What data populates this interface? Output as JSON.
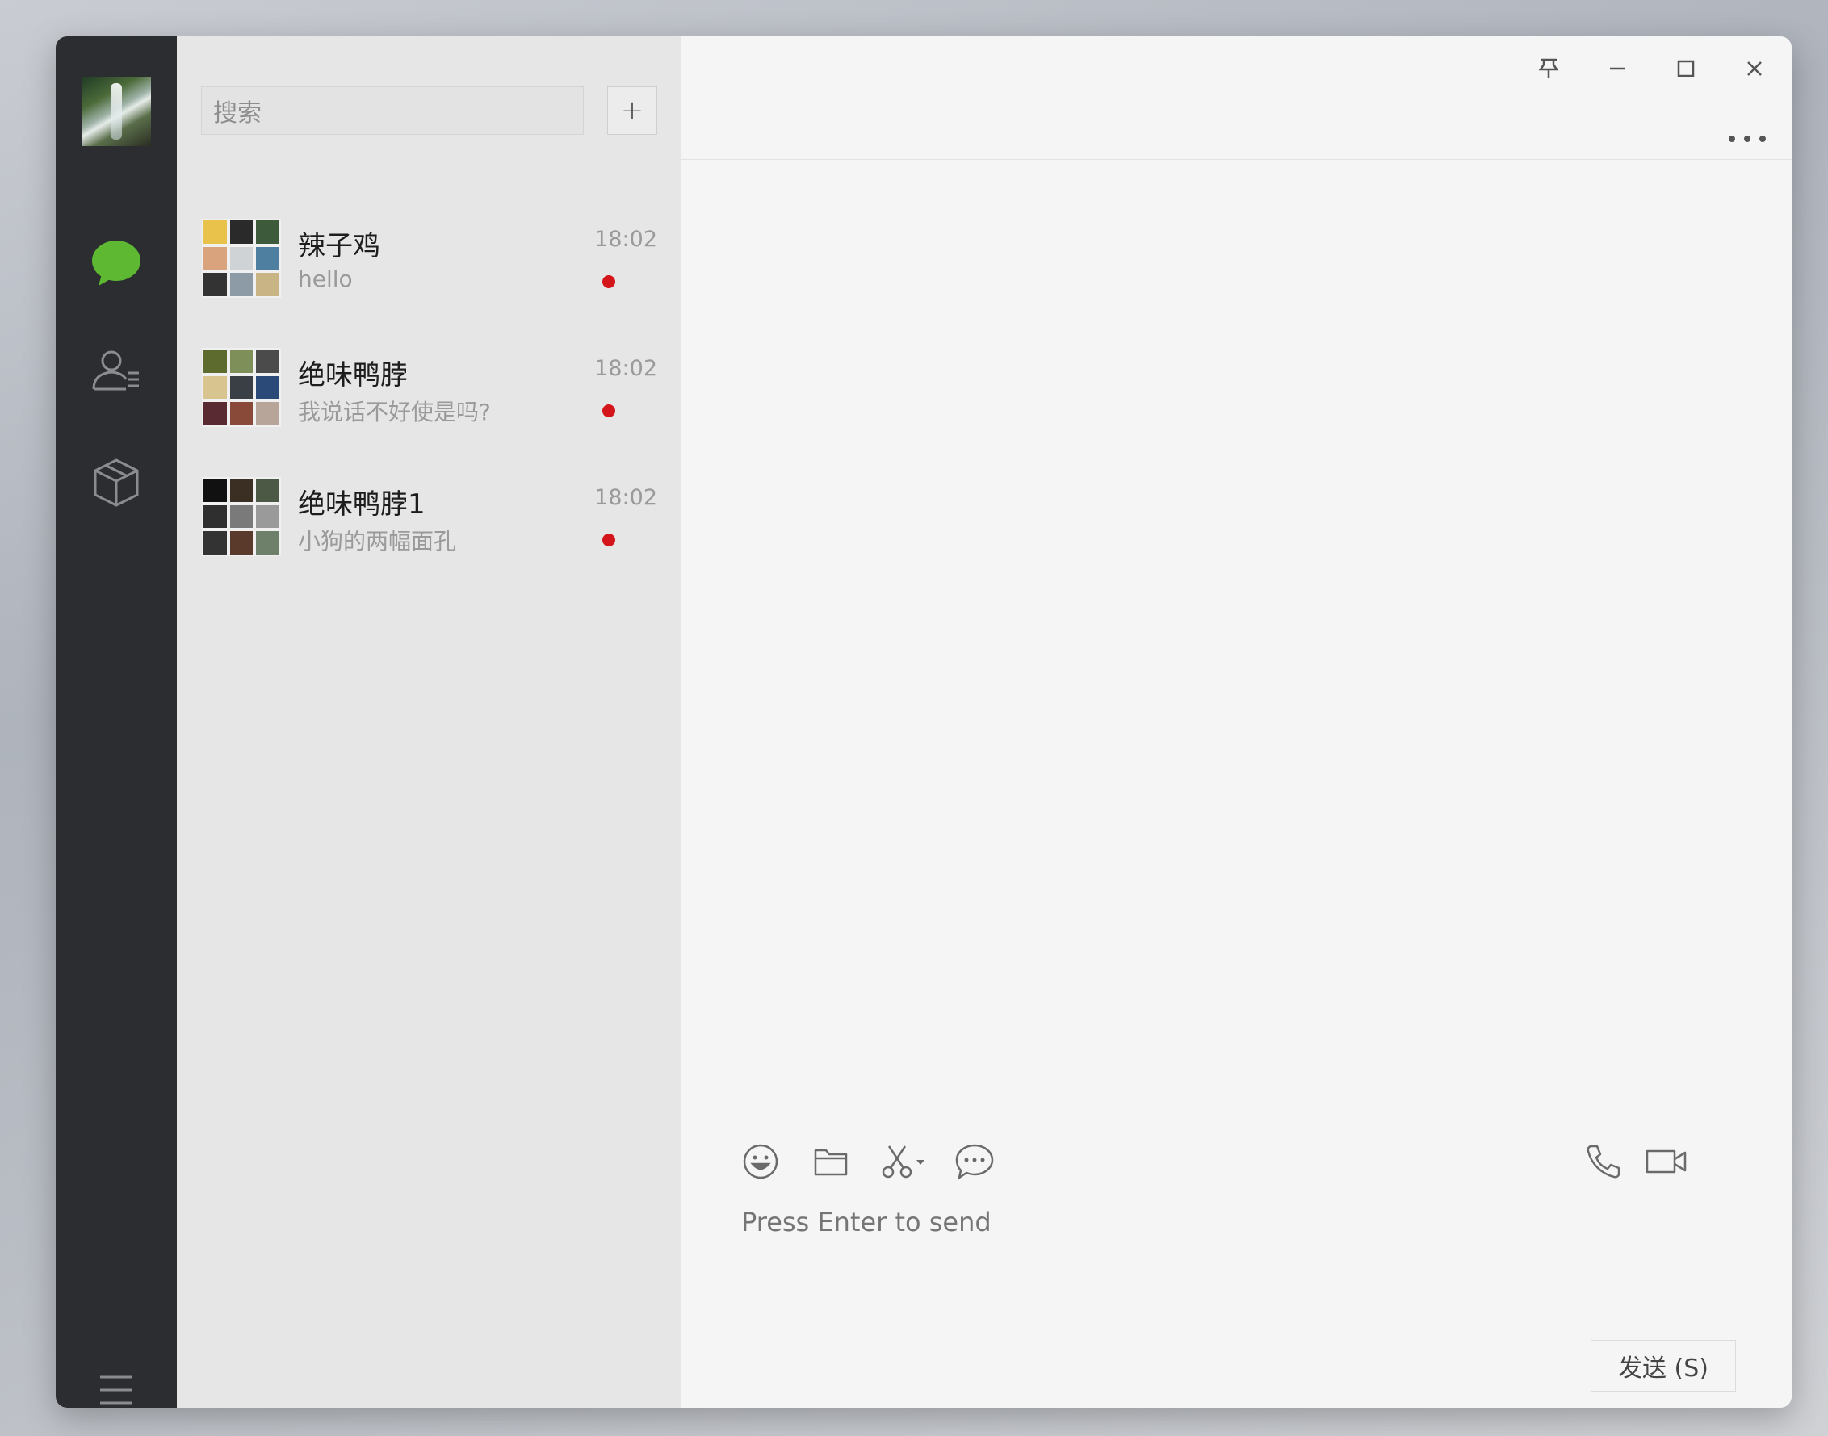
{
  "search": {
    "placeholder": "搜索"
  },
  "list": {
    "add_label": "+"
  },
  "conversations": [
    {
      "name": "辣子鸡",
      "preview": "hello",
      "time": "18:02",
      "unread": true
    },
    {
      "name": "绝味鸭脖",
      "preview": "我说话不好使是吗?",
      "time": "18:02",
      "unread": true
    },
    {
      "name": "绝味鸭脖1",
      "preview": "小狗的两幅面孔",
      "time": "18:02",
      "unread": true
    }
  ],
  "composer": {
    "placeholder": "Press Enter to send",
    "send_label": "发送 (S)"
  },
  "icons": {
    "rail": [
      "chat-icon",
      "contacts-icon",
      "favorites-icon",
      "menu-icon"
    ],
    "titlebar": [
      "pin-icon",
      "minimize-icon",
      "maximize-icon",
      "close-icon",
      "more-icon"
    ],
    "toolbar": [
      "emoji-icon",
      "folder-icon",
      "screenshot-icon",
      "chat-history-icon",
      "voice-call-icon",
      "video-call-icon"
    ]
  },
  "colors": {
    "rail_bg": "#2b2d31",
    "list_bg": "#e6e6e6",
    "main_bg": "#f5f5f5",
    "accent_green": "#5fb832",
    "unread_dot": "#d4161a"
  }
}
